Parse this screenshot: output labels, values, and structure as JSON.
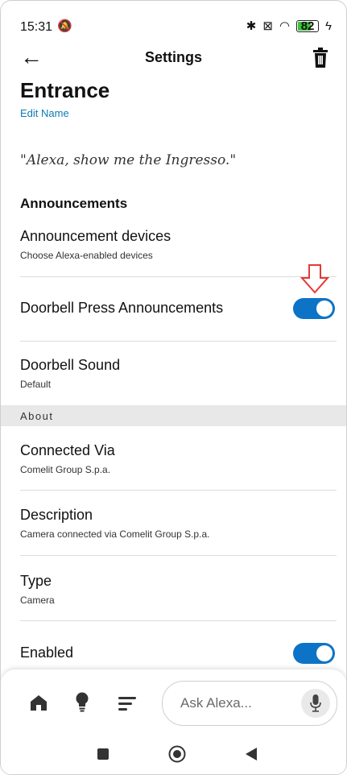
{
  "status_bar": {
    "time": "15:31",
    "battery": "82"
  },
  "header": {
    "title": "Settings"
  },
  "device": {
    "name": "Entrance",
    "edit_name": "Edit Name",
    "quote": "\"Alexa, show me the Ingresso.\""
  },
  "announcements": {
    "section_title": "Announcements",
    "devices_label": "Announcement devices",
    "devices_sub": "Choose Alexa-enabled devices",
    "doorbell_press_label": "Doorbell Press Announcements",
    "doorbell_press_on": true,
    "doorbell_sound_label": "Doorbell Sound",
    "doorbell_sound_value": "Default"
  },
  "about": {
    "section_title": "About",
    "connected_via_label": "Connected Via",
    "connected_via_value": "Comelit Group S.p.a.",
    "description_label": "Description",
    "description_value": "Camera connected via Comelit Group S.p.a.",
    "type_label": "Type",
    "type_value": "Camera",
    "enabled_label": "Enabled",
    "enabled_on": true
  },
  "bottom_nav": {
    "ask_placeholder": "Ask Alexa..."
  },
  "colors": {
    "accent": "#0d73c6",
    "link": "#0b7bb5",
    "annotation_arrow": "#e53935"
  },
  "icons": {
    "back": "arrow-left-icon",
    "trash": "trash-icon",
    "home": "home-icon",
    "bulb": "lightbulb-icon",
    "activity": "list-icon",
    "mic": "microphone-icon"
  }
}
